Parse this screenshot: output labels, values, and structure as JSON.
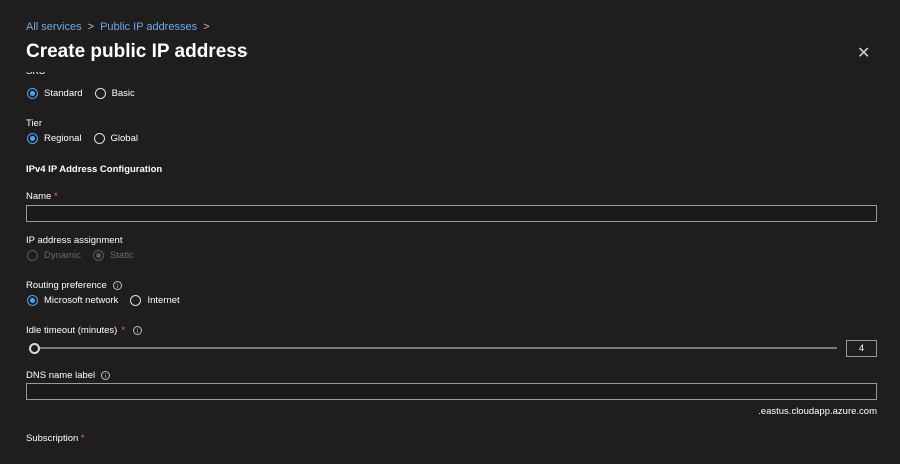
{
  "breadcrumb": {
    "items": [
      "All services",
      "Public IP addresses"
    ],
    "separator": ">"
  },
  "header": {
    "title": "Create public IP address",
    "more_label": "···",
    "close_label": "✕"
  },
  "sku": {
    "label": "SKU",
    "options": [
      "Standard",
      "Basic"
    ],
    "selected": "Standard"
  },
  "tier": {
    "label": "Tier",
    "options": [
      "Regional",
      "Global"
    ],
    "selected": "Regional"
  },
  "ipv4": {
    "section_title": "IPv4 IP Address Configuration",
    "name_label": "Name",
    "required_marker": "*",
    "name_value": "",
    "assignment_label": "IP address assignment",
    "assignment_options": [
      "Dynamic",
      "Static"
    ],
    "assignment_selected": "Static",
    "routing_label": "Routing preference",
    "routing_options": [
      "Microsoft network",
      "Internet"
    ],
    "routing_selected": "Microsoft network",
    "idle_label": "Idle timeout (minutes)",
    "idle_value": "4",
    "dns_label": "DNS name label",
    "dns_value": "",
    "dns_suffix": ".eastus.cloudapp.azure.com",
    "subscription_label": "Subscription"
  },
  "icons": {
    "info": "i"
  },
  "colors": {
    "background": "#1f1d1d",
    "accent": "#4fa3f7",
    "link": "#6ea9e8",
    "required": "#f1707b"
  }
}
